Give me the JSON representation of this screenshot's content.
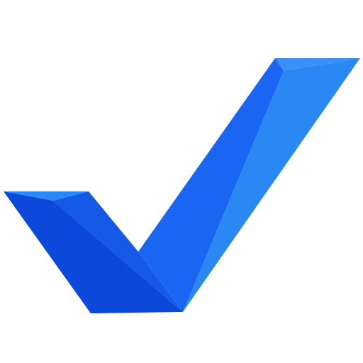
{
  "icon": {
    "name": "checkmark-icon",
    "colors": {
      "background": "#ffffff",
      "face_main": "#1a66f2",
      "face_light": "#2a88f5",
      "face_dark": "#0c48d9",
      "face_mid": "#1559e6",
      "highlight": "#3a90f7"
    }
  }
}
